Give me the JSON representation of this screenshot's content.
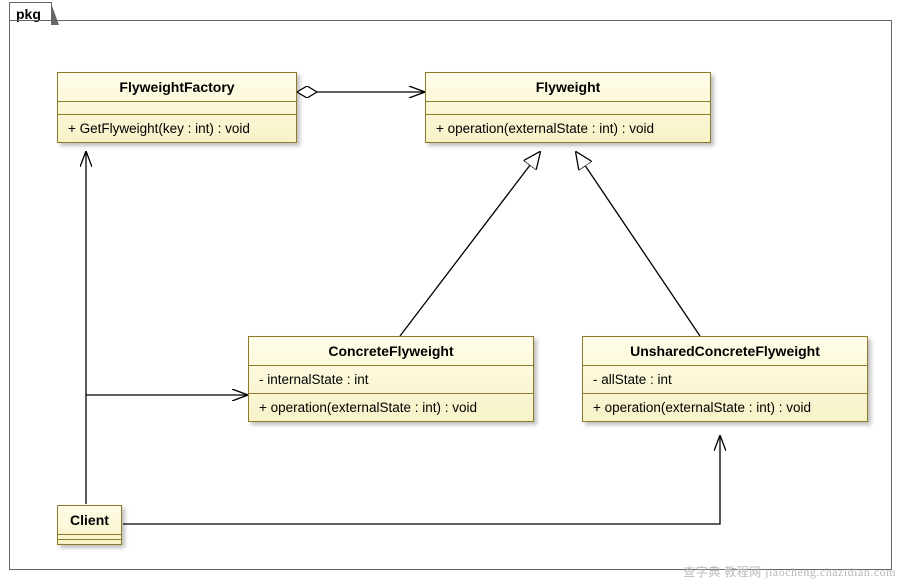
{
  "package": {
    "label": "pkg"
  },
  "classes": {
    "flyweightFactory": {
      "name": "FlyweightFactory",
      "op1": "+ GetFlyweight(key : int) : void"
    },
    "flyweight": {
      "name": "Flyweight",
      "op1": "+ operation(externalState : int) : void"
    },
    "concreteFlyweight": {
      "name": "ConcreteFlyweight",
      "attr1": "- internalState : int",
      "op1": "+ operation(externalState : int) : void"
    },
    "unsharedConcreteFlyweight": {
      "name": "UnsharedConcreteFlyweight",
      "attr1": "- allState : int",
      "op1": "+ operation(externalState : int) : void"
    },
    "client": {
      "name": "Client"
    }
  },
  "watermark": "查字典 教程网  jiaocheng.chazidian.com",
  "chart_data": {
    "type": "uml_class_diagram",
    "package": "pkg",
    "classes": [
      {
        "name": "FlyweightFactory",
        "attributes": [],
        "operations": [
          "+ GetFlyweight(key : int) : void"
        ]
      },
      {
        "name": "Flyweight",
        "attributes": [],
        "operations": [
          "+ operation(externalState : int) : void"
        ]
      },
      {
        "name": "ConcreteFlyweight",
        "attributes": [
          "- internalState : int"
        ],
        "operations": [
          "+ operation(externalState : int) : void"
        ]
      },
      {
        "name": "UnsharedConcreteFlyweight",
        "attributes": [
          "- allState : int"
        ],
        "operations": [
          "+ operation(externalState : int) : void"
        ]
      },
      {
        "name": "Client",
        "attributes": [],
        "operations": []
      }
    ],
    "relationships": [
      {
        "from": "FlyweightFactory",
        "to": "Flyweight",
        "type": "aggregation",
        "owner": "FlyweightFactory"
      },
      {
        "from": "ConcreteFlyweight",
        "to": "Flyweight",
        "type": "generalization"
      },
      {
        "from": "UnsharedConcreteFlyweight",
        "to": "Flyweight",
        "type": "generalization"
      },
      {
        "from": "Client",
        "to": "FlyweightFactory",
        "type": "association"
      },
      {
        "from": "Client",
        "to": "ConcreteFlyweight",
        "type": "association"
      },
      {
        "from": "Client",
        "to": "UnsharedConcreteFlyweight",
        "type": "association"
      }
    ]
  }
}
